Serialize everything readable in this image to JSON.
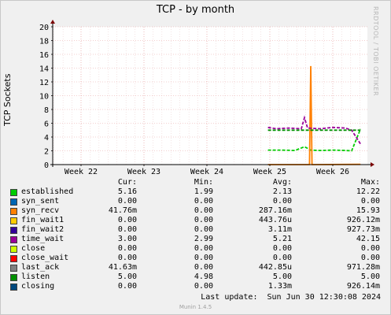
{
  "title": "TCP - by month",
  "side_text": "RRDTOOL / TOBI OETIKER",
  "version": "Munin 1.4.5",
  "last_update": "Last update:  Sun Jun 30 12:30:08 2024",
  "legend_headers": {
    "cur": "Cur:",
    "min": "Min:",
    "avg": "Avg:",
    "max": "Max:"
  },
  "legend": [
    {
      "name": "established",
      "color": "#00cc00",
      "cur": "5.16",
      "min": "1.99",
      "avg": "2.13",
      "max": "12.22"
    },
    {
      "name": "syn_sent",
      "color": "#0066b3",
      "cur": "0.00",
      "min": "0.00",
      "avg": "0.00",
      "max": "0.00"
    },
    {
      "name": "syn_recv",
      "color": "#ff8000",
      "cur": "41.76m",
      "min": "0.00",
      "avg": "287.16m",
      "max": "15.93"
    },
    {
      "name": "fin_wait1",
      "color": "#ffcc00",
      "cur": "0.00",
      "min": "0.00",
      "avg": "443.76u",
      "max": "926.12m"
    },
    {
      "name": "fin_wait2",
      "color": "#330099",
      "cur": "0.00",
      "min": "0.00",
      "avg": "3.11m",
      "max": "927.73m"
    },
    {
      "name": "time_wait",
      "color": "#990099",
      "cur": "3.00",
      "min": "2.99",
      "avg": "5.21",
      "max": "42.15"
    },
    {
      "name": "close",
      "color": "#ccff00",
      "cur": "0.00",
      "min": "0.00",
      "avg": "0.00",
      "max": "0.00"
    },
    {
      "name": "close_wait",
      "color": "#ff0000",
      "cur": "0.00",
      "min": "0.00",
      "avg": "0.00",
      "max": "0.00"
    },
    {
      "name": "last_ack",
      "color": "#808080",
      "cur": "41.63m",
      "min": "0.00",
      "avg": "442.85u",
      "max": "971.28m"
    },
    {
      "name": "listen",
      "color": "#008f00",
      "cur": "5.00",
      "min": "4.98",
      "avg": "5.00",
      "max": "5.00"
    },
    {
      "name": "closing",
      "color": "#00487d",
      "cur": "0.00",
      "min": "0.00",
      "avg": "1.33m",
      "max": "926.14m"
    }
  ],
  "chart_data": {
    "type": "line",
    "ylabel": "TCP Sockets",
    "ylim": [
      0,
      20
    ],
    "y_ticks": [
      0,
      2,
      4,
      6,
      8,
      10,
      12,
      14,
      16,
      18,
      20
    ],
    "x_ticks": [
      "Week 22",
      "Week 23",
      "Week 24",
      "Week 25",
      "Week 26"
    ],
    "x_range_weeks": [
      21.55,
      26.55
    ],
    "grid": true,
    "series": [
      {
        "name": "established",
        "color": "#00cc00",
        "points": [
          [
            24.97,
            2.1
          ],
          [
            25.2,
            2.1
          ],
          [
            25.4,
            2.05
          ],
          [
            25.55,
            2.6
          ],
          [
            25.65,
            2.1
          ],
          [
            25.8,
            2.05
          ],
          [
            26.0,
            2.1
          ],
          [
            26.2,
            2.05
          ],
          [
            26.3,
            2.0
          ],
          [
            26.44,
            5.16
          ]
        ]
      },
      {
        "name": "syn_recv",
        "color": "#ff8000",
        "points": [
          [
            24.97,
            0
          ],
          [
            25.63,
            0
          ],
          [
            25.65,
            14.3
          ],
          [
            25.67,
            0
          ],
          [
            26.44,
            0.04
          ]
        ]
      },
      {
        "name": "time_wait",
        "color": "#990099",
        "points": [
          [
            24.97,
            5.4
          ],
          [
            25.1,
            5.2
          ],
          [
            25.3,
            5.3
          ],
          [
            25.5,
            5.2
          ],
          [
            25.55,
            6.8
          ],
          [
            25.6,
            5.3
          ],
          [
            25.8,
            5.2
          ],
          [
            26.0,
            5.4
          ],
          [
            26.2,
            5.3
          ],
          [
            26.3,
            5.0
          ],
          [
            26.44,
            3.0
          ]
        ]
      },
      {
        "name": "listen",
        "color": "#008f00",
        "points": [
          [
            24.97,
            5.0
          ],
          [
            26.44,
            5.0
          ]
        ]
      }
    ]
  }
}
